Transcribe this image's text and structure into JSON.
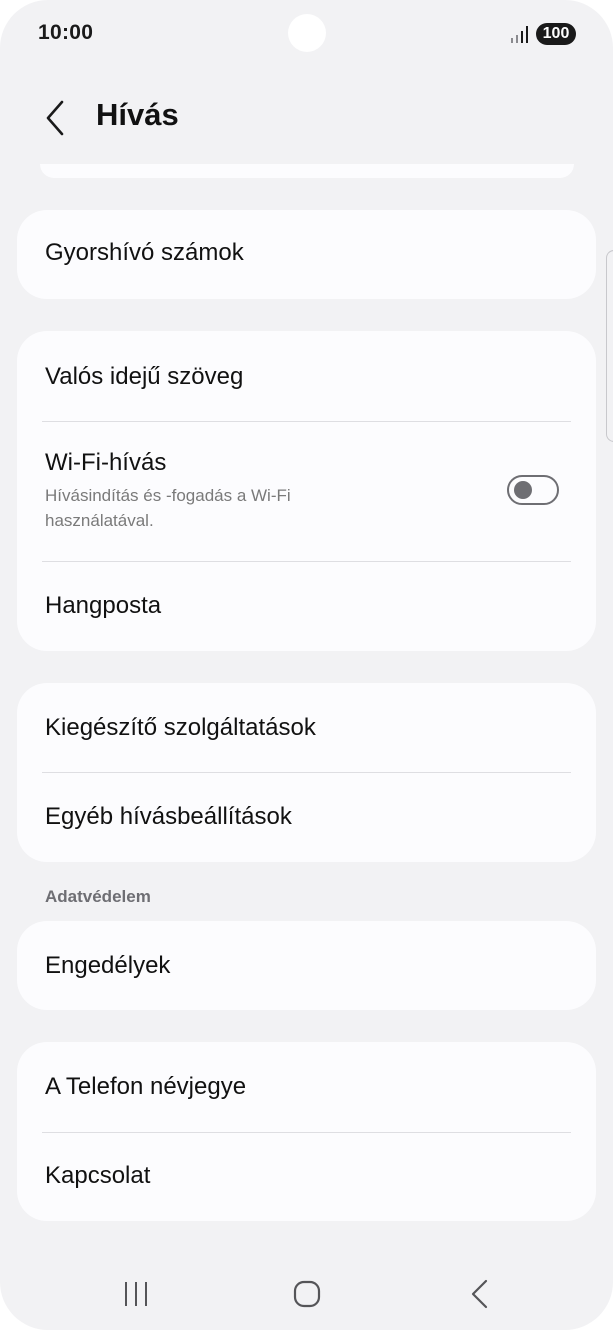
{
  "status_bar": {
    "time": "10:00",
    "battery": "100",
    "signal_icon": "signal-bars-icon"
  },
  "header": {
    "back_icon": "chevron-left-icon",
    "title": "Hívás"
  },
  "cards": {
    "speed_dial": {
      "label": "Gyorshívó számok"
    },
    "calling_features": {
      "rtt_label": "Valós idejű szöveg",
      "wifi_calling_label": "Wi-Fi-hívás",
      "wifi_calling_sub": "Hívásindítás és -fogadás a Wi-Fi használatával.",
      "wifi_calling_enabled": false,
      "voicemail_label": "Hangposta"
    },
    "more": {
      "supplementary_label": "Kiegészítő szolgáltatások",
      "other_settings_label": "Egyéb hívásbeállítások"
    },
    "privacy": {
      "section_header": "Adatvédelem",
      "permissions_label": "Engedélyek"
    },
    "about": {
      "about_label": "A Telefon névjegye",
      "contact_label": "Kapcsolat"
    }
  },
  "nav_bar": {
    "recents_icon": "recent-apps-icon",
    "home_icon": "home-icon",
    "back_icon": "back-icon"
  },
  "colors": {
    "background": "#f2f2f4",
    "card": "#fcfcfe",
    "secondary_text": "#7a7a7a",
    "toggle_off": "#6e6e73"
  }
}
